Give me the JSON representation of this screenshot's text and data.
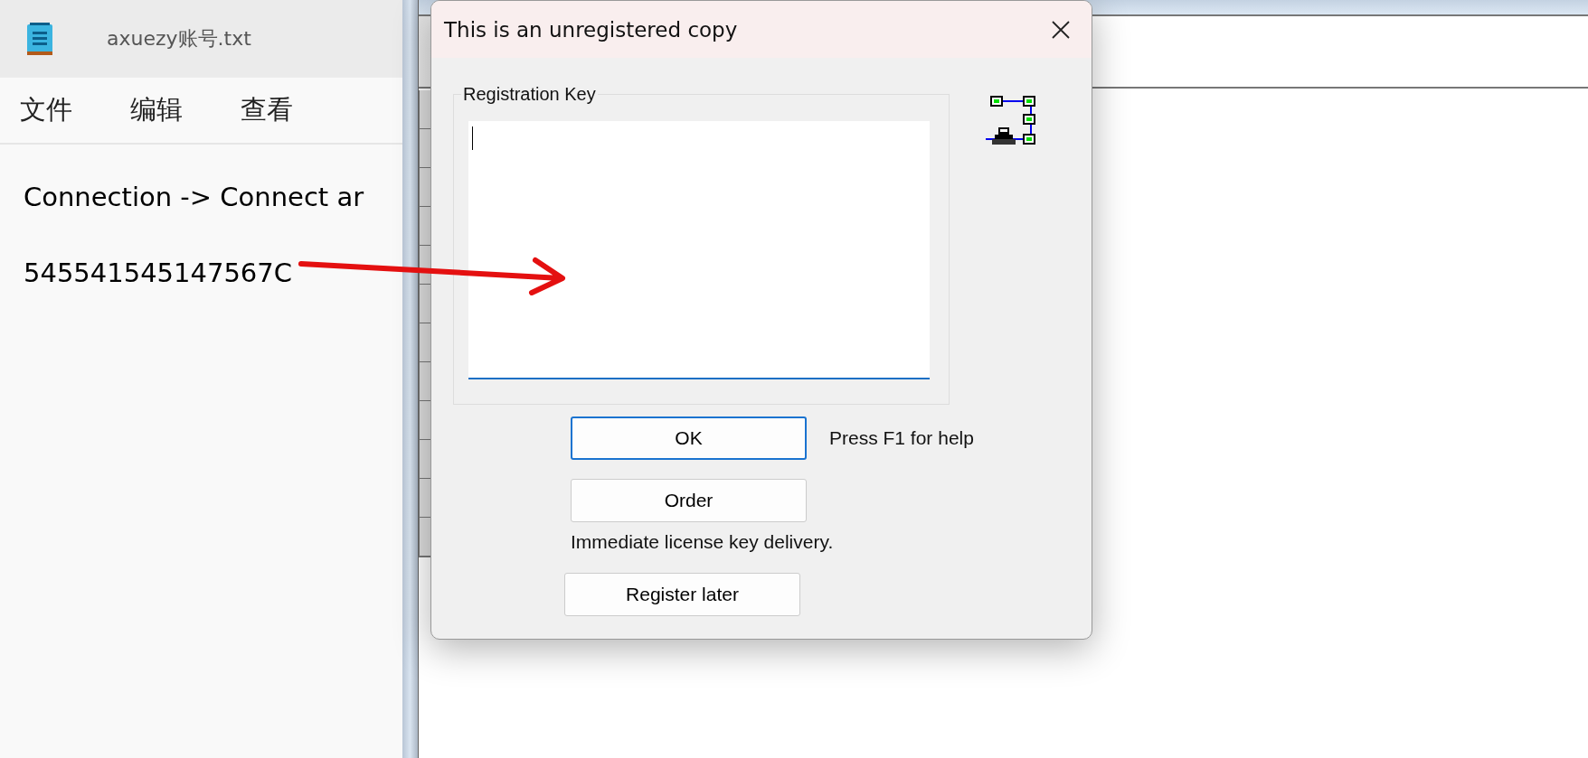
{
  "notepad": {
    "title": "axuezy账号.txt",
    "menu": [
      "文件",
      "编辑",
      "查看"
    ],
    "lines": [
      "Connection -> Connect ar",
      "545541545147567C"
    ]
  },
  "dialog": {
    "title": "This is an unregistered copy",
    "group_label": "Registration Key",
    "key_field": {
      "focused": true
    },
    "buttons": [
      {
        "label": "OK",
        "default": true
      },
      {
        "label": "Order",
        "default": false
      },
      {
        "label": "Register later",
        "default": false
      }
    ],
    "help_text": "Press F1 for help",
    "order_note": "Immediate license key delivery."
  }
}
